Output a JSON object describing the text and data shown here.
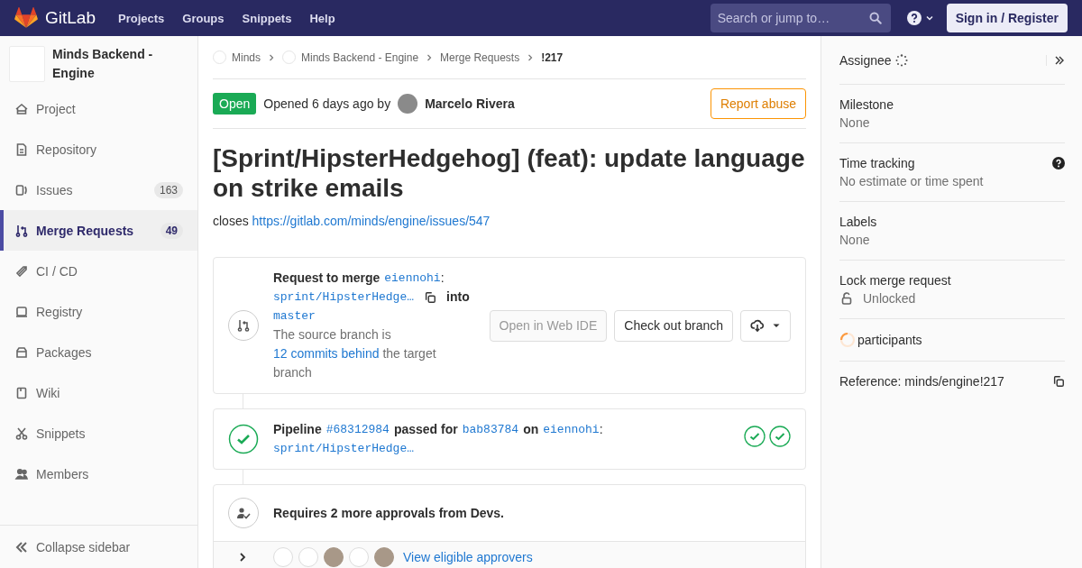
{
  "navbar": {
    "brand": "GitLab",
    "links": [
      "Projects",
      "Groups",
      "Snippets",
      "Help"
    ],
    "search": {
      "placeholder": "Search or jump to…"
    },
    "sign_in": "Sign in / Register"
  },
  "sidebar": {
    "project_name": "Minds Backend - Engine",
    "items": [
      {
        "label": "Project",
        "selected": false
      },
      {
        "label": "Repository",
        "selected": false
      },
      {
        "label": "Issues",
        "count": "163",
        "selected": false
      },
      {
        "label": "Merge Requests",
        "count": "49",
        "selected": true
      },
      {
        "label": "CI / CD",
        "selected": false
      },
      {
        "label": "Registry",
        "selected": false
      },
      {
        "label": "Packages",
        "selected": false
      },
      {
        "label": "Wiki",
        "selected": false
      },
      {
        "label": "Snippets",
        "selected": false
      },
      {
        "label": "Members",
        "selected": false
      }
    ],
    "collapse": "Collapse sidebar"
  },
  "breadcrumbs": [
    {
      "label": "Minds",
      "avatar": true
    },
    {
      "label": "Minds Backend - Engine",
      "avatar": true
    },
    {
      "label": "Merge Requests",
      "avatar": false
    },
    {
      "label": "!217",
      "avatar": false
    }
  ],
  "header": {
    "status": "Open",
    "opened": "Opened 6 days ago by",
    "author": "Marcelo Rivera",
    "report": "Report abuse"
  },
  "title": "[Sprint/HipsterHedgehog] (feat): update language on strike emails",
  "description": {
    "prefix": "closes",
    "link": "https://gitlab.com/minds/engine/issues/547"
  },
  "merge_widget": {
    "heading": [
      {
        "kind": "bold",
        "text": "Request to merge"
      },
      {
        "kind": "code",
        "text": "eiennohi"
      },
      {
        "kind": "plain",
        "text": ":"
      },
      {
        "kind": "code",
        "text": "sprint/HipsterHedge…"
      },
      {
        "kind": "copy"
      },
      {
        "kind": "bold",
        "text": "into"
      },
      {
        "kind": "code",
        "text": "master"
      }
    ],
    "status": [
      {
        "kind": "plain",
        "text": "The source branch is "
      },
      {
        "kind": "link",
        "text": "12 commits behind"
      },
      {
        "kind": "plain",
        "text": " the target branch"
      }
    ],
    "buttons": [
      {
        "label": "Open in Web IDE",
        "disabled": true
      },
      {
        "label": "Check out branch",
        "disabled": false
      }
    ]
  },
  "pipeline": {
    "heading": [
      {
        "kind": "bold",
        "text": "Pipeline"
      },
      {
        "kind": "code",
        "text": "#68312984"
      },
      {
        "kind": "bold",
        "text": "passed for"
      },
      {
        "kind": "code",
        "text": "bab83784"
      },
      {
        "kind": "bold",
        "text": "on"
      },
      {
        "kind": "code",
        "text": "eiennohi"
      },
      {
        "kind": "plain",
        "text": ":"
      },
      {
        "kind": "code",
        "text": "sprint/HipsterHedge…"
      }
    ],
    "stages": [
      {
        "passed": true
      },
      {
        "passed": true
      }
    ]
  },
  "approvals": {
    "text": "Requires 2 more approvals from Devs.",
    "approvers": [
      {
        "kind": "empty"
      },
      {
        "kind": "empty"
      },
      {
        "kind": "photo"
      },
      {
        "kind": "empty"
      },
      {
        "kind": "photo"
      }
    ],
    "link": "View eligible approvers"
  },
  "right_sidebar": {
    "assignee": "Assignee",
    "blocks": [
      {
        "kind": "value",
        "label": "Milestone",
        "value": "None",
        "help": false
      },
      {
        "kind": "value",
        "label": "Time tracking",
        "value": "No estimate or time spent",
        "help": true
      },
      {
        "kind": "value",
        "label": "Labels",
        "value": "None",
        "help": false
      },
      {
        "kind": "lock",
        "label": "Lock merge request",
        "value": "Unlocked",
        "help": false
      },
      {
        "kind": "participants",
        "label": "participants"
      }
    ],
    "reference": "Reference: minds/engine!217"
  }
}
